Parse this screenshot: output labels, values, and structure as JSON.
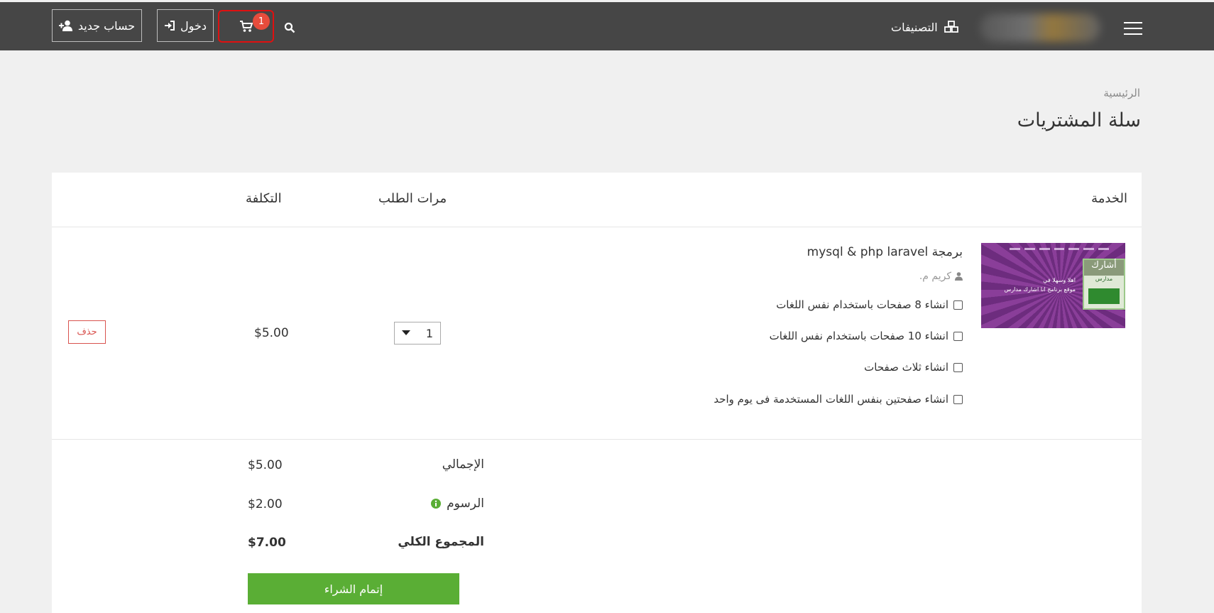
{
  "nav": {
    "register_label": "حساب جديد",
    "login_label": "دخول",
    "cart_count": "1",
    "categories_label": "التصنيفات"
  },
  "breadcrumb": {
    "home": "الرئيسية"
  },
  "page": {
    "title": "سلة المشتريات"
  },
  "table": {
    "headers": {
      "service": "الخدمة",
      "quantity": "مرات الطلب",
      "cost": "التكلفة"
    }
  },
  "item": {
    "title": "برمجة mysql & php laravel",
    "seller": "كريم م.",
    "thumbnail": {
      "banner_text": "أشارك",
      "banner_sub": "مدارس",
      "caption_1": "اهلا وسهلا في",
      "caption_2": "موقع برنامج انا اشارك مدارس"
    },
    "options": [
      "انشاء 8 صفحات باستخدام نفس اللغات",
      "انشاء 10 صفحات باستخدام نفس اللغات",
      "انشاء ثلاث صفحات",
      "انشاء صفحتين بنفس اللغات المستخدمة فى يوم واحد"
    ],
    "quantity": "1",
    "price": "$5.00",
    "delete_label": "حذف"
  },
  "summary": {
    "subtotal_label": "الإجمالي",
    "subtotal_value": "$5.00",
    "fees_label": "الرسوم",
    "fees_value": "$2.00",
    "total_label": "المجموع الكلي",
    "total_value": "$7.00",
    "checkout_label": "إتمام الشراء"
  },
  "colors": {
    "topbar": "#464646",
    "checkout": "#5aae35",
    "delete": "#d9534f",
    "badge": "#e74c3c"
  }
}
